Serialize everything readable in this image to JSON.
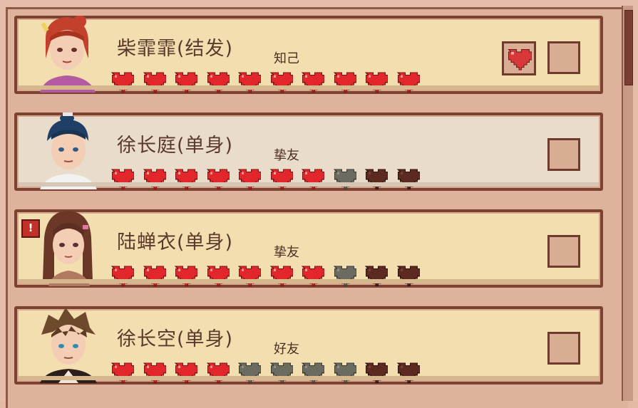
{
  "colors": {
    "heart_full": "#e1262c",
    "heart_dim": "#6b6b5f",
    "heart_dark": "#5c2a20",
    "card_border": "#7c4231",
    "card_bg": "#f3deb0",
    "card_bg_selected": "#e9dccb"
  },
  "characters": [
    {
      "name": "柴霏霏(结发)",
      "relation": "知己",
      "hearts": [
        "full",
        "full",
        "full",
        "full",
        "full",
        "full",
        "full",
        "full",
        "full",
        "full"
      ],
      "has_gift_heart": true,
      "alert": false
    },
    {
      "name": "徐长庭(单身)",
      "relation": "挚友",
      "hearts": [
        "full",
        "full",
        "full",
        "full",
        "full",
        "full",
        "full",
        "gray",
        "dark",
        "dark"
      ],
      "has_gift_heart": false,
      "alert": false
    },
    {
      "name": "陆蝉衣(单身)",
      "relation": "挚友",
      "hearts": [
        "full",
        "full",
        "full",
        "full",
        "full",
        "full",
        "full",
        "gray",
        "dark",
        "dark"
      ],
      "has_gift_heart": false,
      "alert": true,
      "alert_symbol": "!"
    },
    {
      "name": "徐长空(单身)",
      "relation": "好友",
      "hearts": [
        "full",
        "full",
        "full",
        "full",
        "gray",
        "gray",
        "gray",
        "gray",
        "dark",
        "dark"
      ],
      "has_gift_heart": false,
      "alert": false
    }
  ]
}
